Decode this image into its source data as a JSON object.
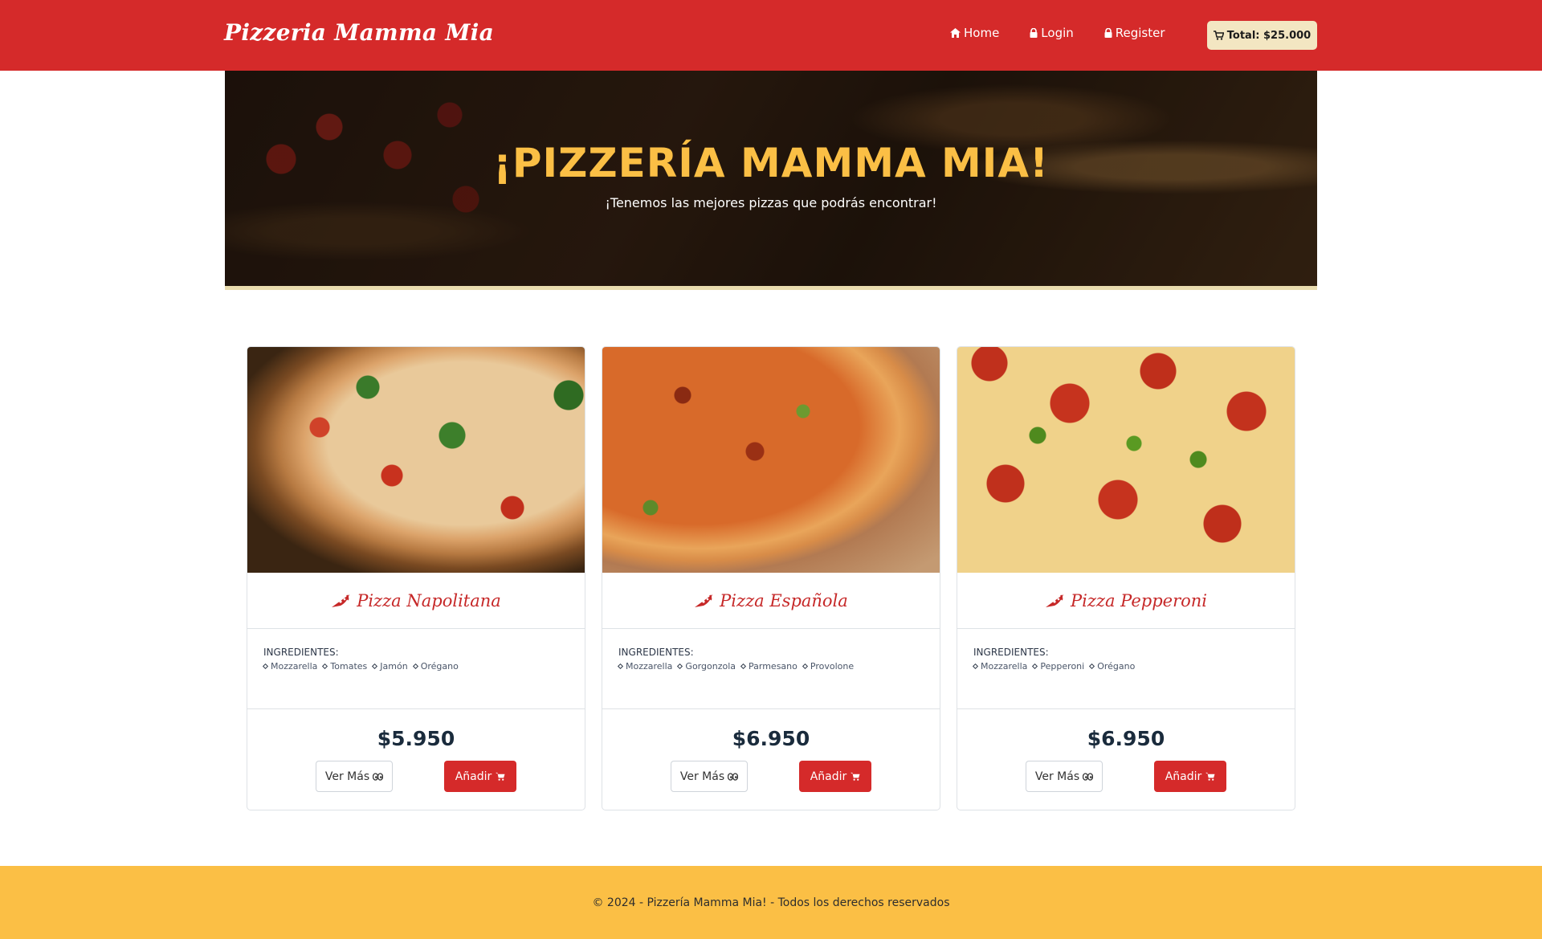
{
  "navbar": {
    "brand": "Pizzeria Mamma Mia",
    "links": [
      {
        "label": "Home",
        "icon": "home-icon"
      },
      {
        "label": "Login",
        "icon": "lock-icon"
      },
      {
        "label": "Register",
        "icon": "lock-icon"
      }
    ],
    "cart_total": "Total: $25.000"
  },
  "hero": {
    "title": "¡PIZZERÍA MAMMA MIA!",
    "subtitle": "¡Tenemos las mejores pizzas que podrás encontrar!"
  },
  "pizzas": [
    {
      "name": "Pizza Napolitana",
      "ingredients_label": "INGREDIENTES:",
      "ingredients": [
        "Mozzarella",
        "Tomates",
        "Jamón",
        "Orégano"
      ],
      "price": "$5.950",
      "more_label": "Ver Más",
      "add_label": "Añadir"
    },
    {
      "name": "Pizza Española",
      "ingredients_label": "INGREDIENTES:",
      "ingredients": [
        "Mozzarella",
        "Gorgonzola",
        "Parmesano",
        "Provolone"
      ],
      "price": "$6.950",
      "more_label": "Ver Más",
      "add_label": "Añadir"
    },
    {
      "name": "Pizza Pepperoni",
      "ingredients_label": "INGREDIENTES:",
      "ingredients": [
        "Mozzarella",
        "Pepperoni",
        "Orégano"
      ],
      "price": "$6.950",
      "more_label": "Ver Más",
      "add_label": "Añadir"
    }
  ],
  "footer": {
    "text": "© 2024 - Pizzería Mamma Mia! - Todos los derechos reservados"
  },
  "colors": {
    "primary_red": "#d52a2a",
    "accent_yellow": "#fbbf45",
    "cart_bg": "#f3e6c2"
  }
}
